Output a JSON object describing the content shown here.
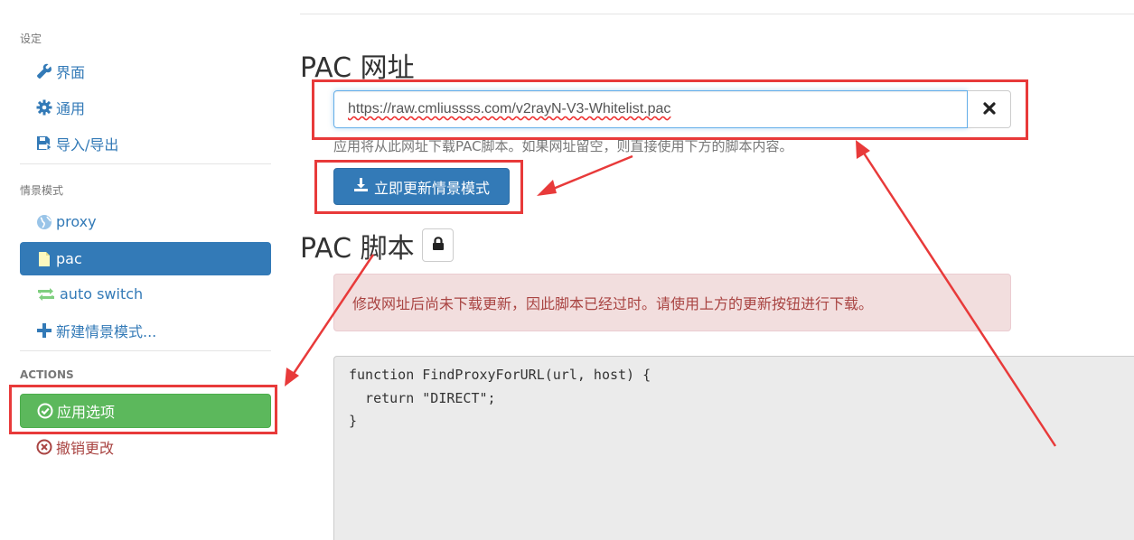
{
  "sidebar": {
    "settings_header": "设定",
    "settings_items": [
      {
        "label": "界面",
        "icon": "wrench-icon"
      },
      {
        "label": "通用",
        "icon": "gear-icon"
      },
      {
        "label": "导入/导出",
        "icon": "import-export-icon"
      }
    ],
    "profiles_header": "情景模式",
    "profiles": [
      {
        "label": "proxy",
        "icon": "globe-icon",
        "active": false
      },
      {
        "label": "pac",
        "icon": "file-icon",
        "active": true
      },
      {
        "label": "auto switch",
        "icon": "retweet-icon",
        "active": false
      },
      {
        "label": "新建情景模式...",
        "icon": "plus-icon",
        "active": false
      }
    ],
    "actions_header": "ACTIONS",
    "apply_label": "应用选项",
    "discard_label": "撤销更改"
  },
  "main": {
    "pac_url_title": "PAC 网址",
    "pac_url_value": "https://raw.cmliussss.com/v2rayN-V3-Whitelist.pac",
    "pac_url_help": "应用将从此网址下载PAC脚本。如果网址留空，则直接使用下方的脚本内容。",
    "update_button": "立即更新情景模式",
    "pac_script_title": "PAC 脚本",
    "alert_text": "修改网址后尚未下载更新，因此脚本已经过时。请使用上方的更新按钮进行下载。",
    "script_lines": [
      "function FindProxyForURL(url, host) {",
      "  return \"DIRECT\";",
      "}"
    ]
  },
  "colors": {
    "primary": "#337ab7",
    "success": "#5cb85c",
    "danger_text": "#a94442",
    "annotation": "#e83a3a"
  }
}
